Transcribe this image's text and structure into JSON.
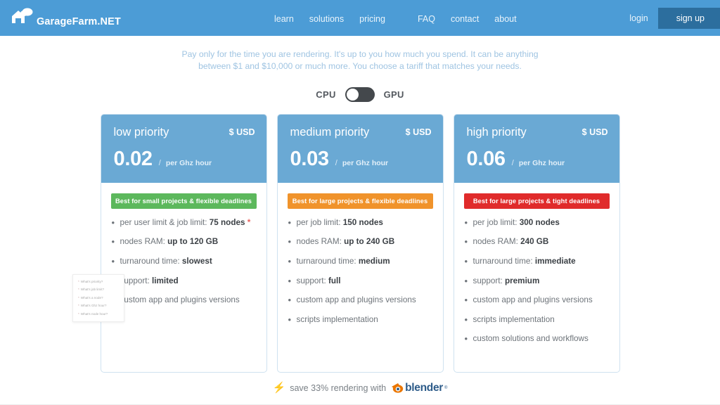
{
  "brand": {
    "name": "GarageFarm.NET",
    "logo_icon": "garage-cloud-logo"
  },
  "nav": {
    "links": [
      {
        "label": "learn"
      },
      {
        "label": "solutions"
      },
      {
        "label": "pricing"
      },
      {
        "label": "FAQ"
      },
      {
        "label": "contact"
      },
      {
        "label": "about"
      }
    ],
    "login_label": "login",
    "signup_label": "sign up"
  },
  "intro": {
    "line1": "Pay only for the time you are rendering. It's up to you how much you spend. It can be anything",
    "line2": "between $1 and $10,000 or much more. You choose a tariff that matches your needs."
  },
  "toggle": {
    "left_label": "CPU",
    "right_label": "GPU",
    "selected": "CPU"
  },
  "cards": [
    {
      "title": "low priority",
      "currency": "$ USD",
      "price": "0.02",
      "slash": "/",
      "unit": "per Ghz hour",
      "badge": "Best for small projects & flexible deadlines",
      "badge_color": "#5cb85c",
      "features": [
        {
          "text": "per user limit & job limit: ",
          "bold": "75 nodes",
          "suffix": " *"
        },
        {
          "text": "nodes RAM: ",
          "bold": "up to 120 GB",
          "suffix": ""
        },
        {
          "text": "turnaround time: ",
          "bold": "slowest",
          "suffix": ""
        },
        {
          "text": "support: ",
          "bold": "limited",
          "suffix": ""
        },
        {
          "text": "custom app and plugins versions",
          "bold": "",
          "suffix": ""
        }
      ]
    },
    {
      "title": "medium priority",
      "currency": "$ USD",
      "price": "0.03",
      "slash": "/",
      "unit": "per Ghz hour",
      "badge": "Best for large projects & flexible deadlines",
      "badge_color": "#f0932b",
      "features": [
        {
          "text": "per job limit: ",
          "bold": "150 nodes",
          "suffix": ""
        },
        {
          "text": "nodes RAM: ",
          "bold": "up to 240 GB",
          "suffix": ""
        },
        {
          "text": "turnaround time: ",
          "bold": "medium",
          "suffix": ""
        },
        {
          "text": "support: ",
          "bold": "full",
          "suffix": ""
        },
        {
          "text": "custom app and plugins versions",
          "bold": "",
          "suffix": ""
        },
        {
          "text": "scripts implementation",
          "bold": "",
          "suffix": ""
        }
      ]
    },
    {
      "title": "high priority",
      "currency": "$ USD",
      "price": "0.06",
      "slash": "/",
      "unit": "per Ghz hour",
      "badge": "Best for large projects & tight deadlines",
      "badge_color": "#e02b2b",
      "features": [
        {
          "text": "per job limit: ",
          "bold": "300 nodes",
          "suffix": ""
        },
        {
          "text": "nodes RAM: ",
          "bold": "240 GB",
          "suffix": ""
        },
        {
          "text": "turnaround time: ",
          "bold": "immediate",
          "suffix": ""
        },
        {
          "text": "support: ",
          "bold": "premium",
          "suffix": ""
        },
        {
          "text": "custom app and plugins versions",
          "bold": "",
          "suffix": ""
        },
        {
          "text": "scripts implementation",
          "bold": "",
          "suffix": ""
        },
        {
          "text": "custom solutions and workflows",
          "bold": "",
          "suffix": ""
        }
      ]
    }
  ],
  "faq_box": {
    "items": [
      "What's priority?",
      "What's job limit?",
      "What's a node?",
      "What's Ghz hour?",
      "What's node hour?"
    ]
  },
  "footer": {
    "bolt_icon": "lightning-bolt-icon",
    "text": "save 33% rendering with",
    "logo_word": "blender",
    "logo_tm": "®"
  },
  "colors": {
    "nav_blue": "#4c9cd6",
    "card_header_blue": "#6aa9d4",
    "signup_blue": "#2c6e9e",
    "intro_text": "#9fc4e2",
    "badge_green": "#5cb85c",
    "badge_orange": "#f0932b",
    "badge_red": "#e02b2b"
  }
}
